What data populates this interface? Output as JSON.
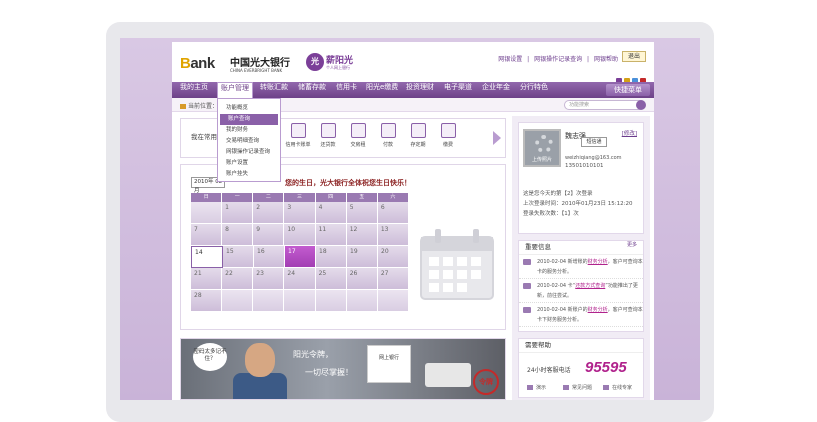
{
  "header": {
    "bank_logo_b": "B",
    "bank_logo_rest": "ank",
    "bank_name_cn": "中国光大银行",
    "bank_name_en": "CHINA EVERBRIGHT BANK",
    "brand_badge": "光",
    "brand_name": "薪阳光",
    "brand_sub": "个人网上银行",
    "links": [
      "网银设置",
      "|",
      "网银操作记录查询",
      "|",
      "网银帮助"
    ],
    "exit_label": "退出",
    "theme_colors": [
      "#7b3f98",
      "#d4a017",
      "#4a90d9",
      "#c42a2a"
    ]
  },
  "nav": {
    "items": [
      "我的主页",
      "账户管理",
      "转账汇款",
      "储蓄存款",
      "信用卡",
      "阳光e缴费",
      "投资理财",
      "电子渠道",
      "企业年金",
      "分行特色"
    ],
    "active_index": 1,
    "quick_menu": "快捷菜单"
  },
  "subbar": {
    "crumb": "当前位置：",
    "search_placeholder": "功能搜索"
  },
  "dropdown": {
    "items": [
      "功能概览",
      "账户查询",
      "我的财务",
      "交易明细查询",
      "网银操作记录查询",
      "账户设置",
      "账户挂失"
    ],
    "selected_index": 1
  },
  "favorites": {
    "title": "我在常用",
    "items": [
      "信用卡账单",
      "还贷款",
      "交房租",
      "付款",
      "存定期",
      "缴费"
    ]
  },
  "calendar": {
    "month_select": "2010年 02月",
    "greeting": "您的生日，光大银行全体祝您生日快乐！",
    "weekdays": [
      "日",
      "一",
      "二",
      "三",
      "四",
      "五",
      "六"
    ],
    "rows": [
      [
        "",
        "1",
        "2",
        "3",
        "4",
        "5",
        "6"
      ],
      [
        "7",
        "8",
        "9",
        "10",
        "11",
        "12",
        "13"
      ],
      [
        "14",
        "15",
        "16",
        "17",
        "18",
        "19",
        "20"
      ],
      [
        "21",
        "22",
        "23",
        "24",
        "25",
        "26",
        "27"
      ],
      [
        "28",
        "",
        "",
        "",
        "",
        "",
        ""
      ]
    ],
    "today": "14",
    "marked": "17"
  },
  "banner": {
    "bubble": "密码太多记不住？",
    "text1": "阳光令牌，",
    "text2": "一切尽掌握！",
    "box_text": "网上银行",
    "stamp": "令牌"
  },
  "user": {
    "photo_label": "上传照片",
    "name": "魏志强",
    "tip": "短信通",
    "modify": "[修改]",
    "email": "weizhiqiang@163.com",
    "phone": "13501010101",
    "lines": [
      "这是您今天的第【2】次登录",
      "上次登录时间：2010年01月23日 15:12:20",
      "登录失败次数：【1】次"
    ]
  },
  "notices": {
    "title": "重要信息",
    "more": "更多",
    "items": [
      {
        "pre": "2010-02-04  新增账的",
        "link": "财务分析",
        "post": "，客户可查询本卡的服务分析。"
      },
      {
        "pre": "2010-02-04  卡“",
        "link": "还款方式查询",
        "post": "”功能推出了更新，前往尝试。"
      },
      {
        "pre": "2010-02-04  新账户的",
        "link": "财务分析",
        "post": "，客户可查询本卡下财务服务分析。"
      }
    ]
  },
  "help": {
    "title": "需要帮助",
    "hotline_label": "24小时客服电话",
    "hotline_number": "95595",
    "items": [
      "演示",
      "常见问题",
      "在线专家"
    ]
  }
}
